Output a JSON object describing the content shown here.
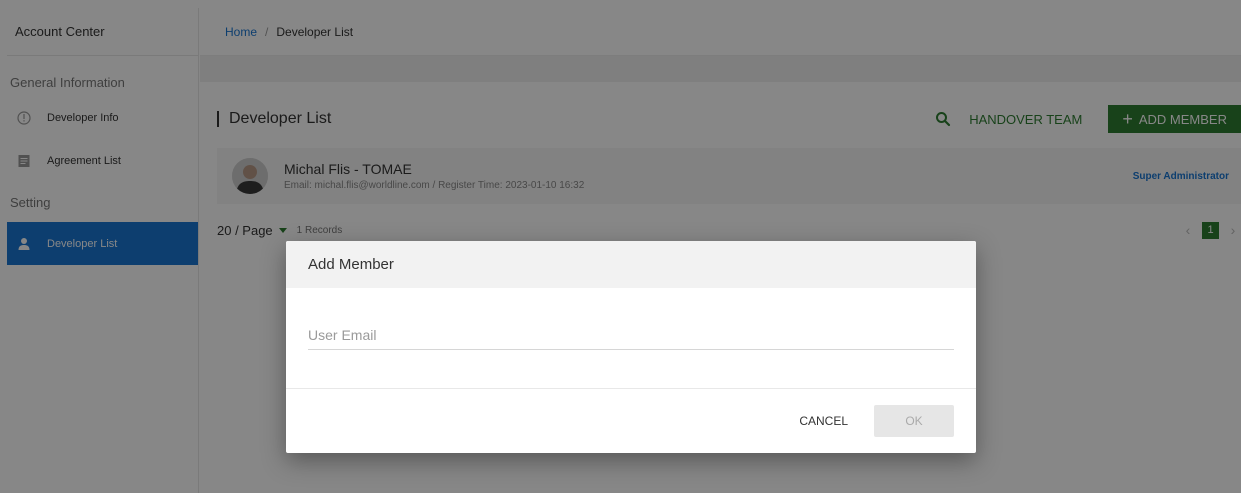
{
  "sidebar": {
    "header": "Account Center",
    "sections": [
      {
        "label": "General Information"
      },
      {
        "label": "Setting"
      }
    ],
    "items": [
      {
        "label": "Developer Info",
        "icon": "info-circle-icon"
      },
      {
        "label": "Agreement List",
        "icon": "document-icon"
      },
      {
        "label": "Developer List",
        "icon": "person-icon",
        "active": true
      }
    ]
  },
  "breadcrumb": {
    "home": "Home",
    "separator": "/",
    "current": "Developer List"
  },
  "list": {
    "title": "Developer List",
    "handover_label": "HANDOVER TEAM",
    "add_member_label": "ADD MEMBER"
  },
  "member": {
    "name": "Michal Flis - TOMAE",
    "details": "Email: michal.flis@worldline.com  /  Register Time: 2023-01-10 16:32",
    "role": "Super Administrator"
  },
  "pagination": {
    "per_page": "20 / Page",
    "records": "1 Records",
    "current_page": "1",
    "prev": "‹",
    "next": "›"
  },
  "dialog": {
    "title": "Add Member",
    "email_placeholder": "User Email",
    "email_value": "",
    "cancel_label": "CANCEL",
    "ok_label": "OK"
  },
  "colors": {
    "primary_blue": "#1976d2",
    "primary_green": "#2e7d32",
    "overlay": "rgba(0,0,0,0.47)"
  }
}
